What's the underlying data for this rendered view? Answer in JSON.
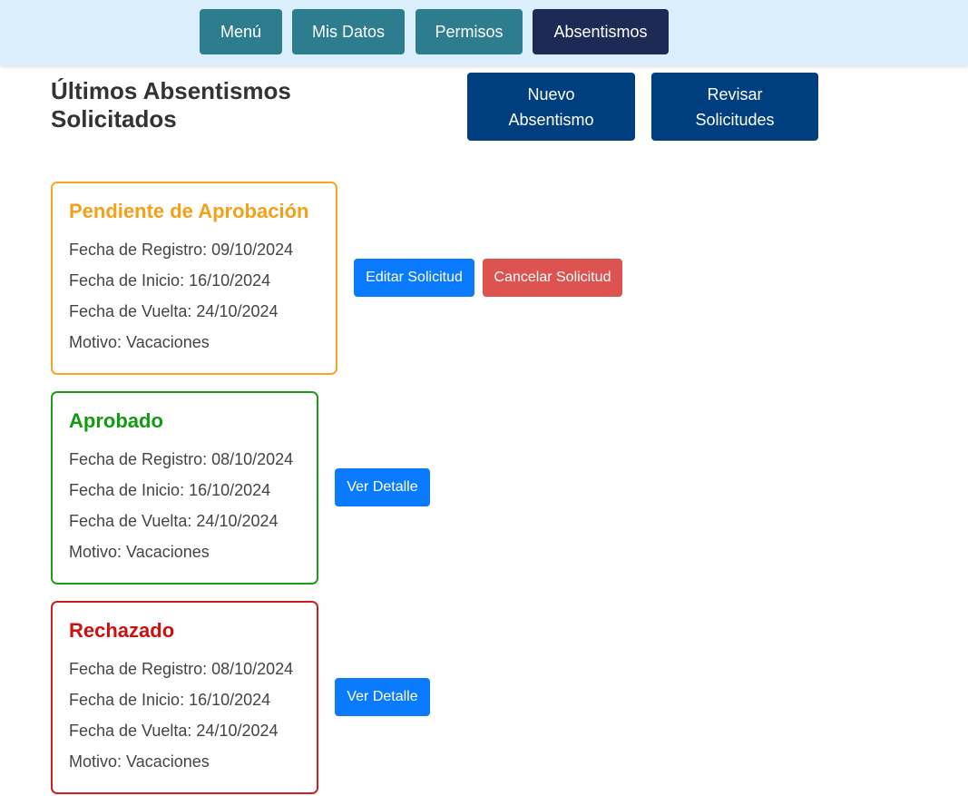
{
  "nav": {
    "menu": "Menú",
    "mis_datos": "Mis Datos",
    "permisos": "Permisos",
    "absentismos": "Absentismos"
  },
  "header": {
    "title": "Últimos Absentismos Solicitados",
    "nuevo_line1": "Nuevo",
    "nuevo_line2": "Absentismo",
    "revisar_line1": "Revisar",
    "revisar_line2": "Solicitudes"
  },
  "requests": [
    {
      "status": "Pendiente de Aprobación",
      "fecha_registro": "Fecha de Registro: 09/10/2024",
      "fecha_inicio": "Fecha de Inicio: 16/10/2024",
      "fecha_vuelta": "Fecha de Vuelta: 24/10/2024",
      "motivo": "Motivo: Vacaciones",
      "edit_label": "Editar Solicitud",
      "cancel_label": "Cancelar Solicitud"
    },
    {
      "status": "Aprobado",
      "fecha_registro": "Fecha de Registro: 08/10/2024",
      "fecha_inicio": "Fecha de Inicio: 16/10/2024",
      "fecha_vuelta": "Fecha de Vuelta: 24/10/2024",
      "motivo": "Motivo: Vacaciones",
      "detail_label": "Ver Detalle"
    },
    {
      "status": "Rechazado",
      "fecha_registro": "Fecha de Registro: 08/10/2024",
      "fecha_inicio": "Fecha de Inicio: 16/10/2024",
      "fecha_vuelta": "Fecha de Vuelta: 24/10/2024",
      "motivo": "Motivo: Vacaciones",
      "detail_label": "Ver Detalle"
    }
  ],
  "colors": {
    "nav_background": "#dbeefc",
    "nav_button": "#2e7d8e",
    "nav_active": "#1c2a55",
    "action_button": "#003f7f",
    "pending": "#f5a623",
    "approved": "#18a118",
    "rejected": "#cc1f1f",
    "primary": "#0a7bff",
    "danger": "#dc5350"
  }
}
